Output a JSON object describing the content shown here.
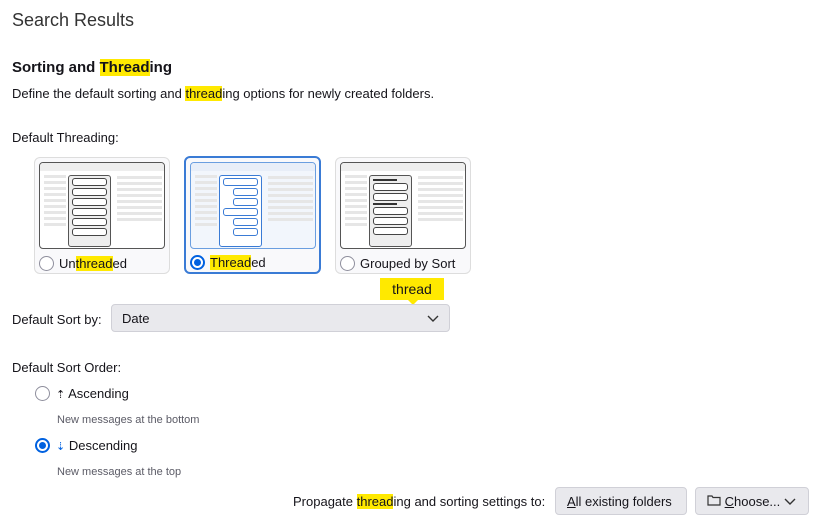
{
  "header": {
    "title": "Search Results"
  },
  "section": {
    "heading": {
      "pre": "Sorting and ",
      "hl": "Thread",
      "post": "ing"
    },
    "description": {
      "pre": "Define the default sorting and ",
      "hl": "thread",
      "post": "ing options for newly created folders."
    }
  },
  "threading": {
    "label": "Default Threading:",
    "options": [
      {
        "pre": "Un",
        "hl": "thread",
        "post": "ed",
        "selected": false
      },
      {
        "pre": "",
        "hl": "Thread",
        "post": "ed",
        "selected": true
      },
      {
        "pre": "Grouped by Sort",
        "hl": "",
        "post": "",
        "selected": false
      }
    ]
  },
  "tooltip": "thread",
  "sort_by": {
    "label": "Default Sort by:",
    "value": "Date"
  },
  "sort_order": {
    "label": "Default Sort Order:",
    "options": [
      {
        "label": "Ascending",
        "hint": "New messages at the bottom",
        "selected": false
      },
      {
        "label": "Descending",
        "hint": "New messages at the top",
        "selected": true
      }
    ]
  },
  "propagate": {
    "pre": "Propagate ",
    "hl": "thread",
    "post": "ing and sorting settings to:",
    "all_key": "A",
    "all_rest": "ll existing folders",
    "choose_key": "C",
    "choose_rest": "hoose..."
  }
}
